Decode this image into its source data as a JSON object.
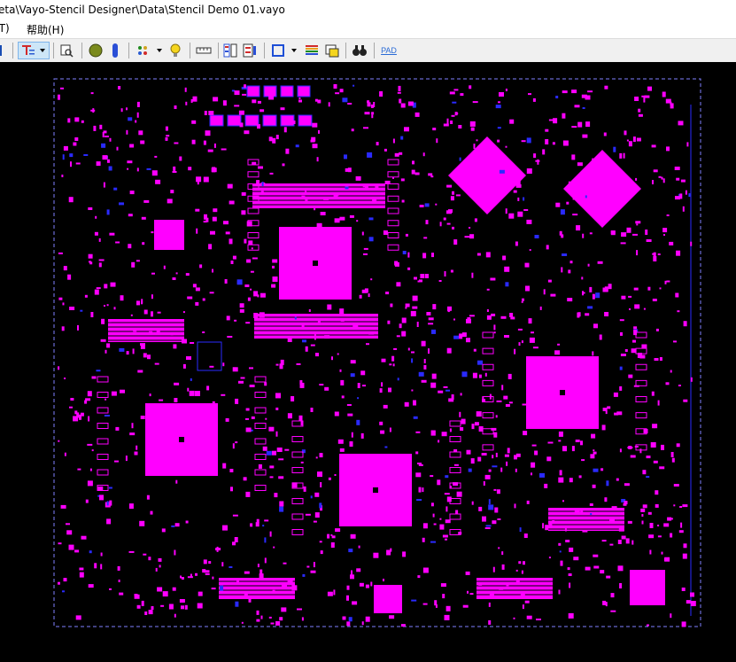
{
  "window": {
    "title": "eta\\Vayo-Stencil Designer\\Data\\Stencil Demo 01.vayo"
  },
  "menu": {
    "items": [
      {
        "label": "(T)"
      },
      {
        "label": "帮助(H)"
      }
    ]
  },
  "toolbar": {
    "pad_label": "PAD"
  },
  "canvas": {
    "background": "#000000",
    "pad_color": "#ff00ff",
    "outline_color": "#2a2aff"
  }
}
